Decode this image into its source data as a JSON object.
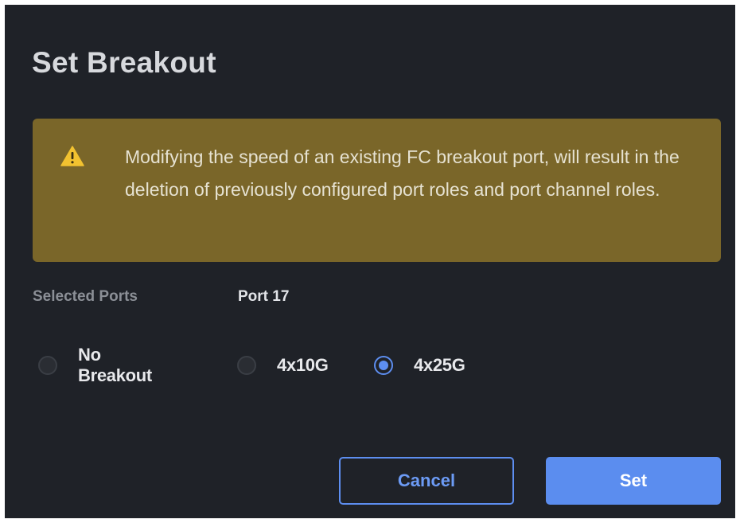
{
  "dialog": {
    "title": "Set Breakout",
    "warning": {
      "icon": "warning-triangle-icon",
      "text": "Modifying the speed of an existing FC breakout port, will result in the deletion of previously configured port roles and port channel roles.",
      "background_color": "#7a6629",
      "icon_color": "#f2c230"
    },
    "selected_ports": {
      "label": "Selected Ports",
      "value": "Port 17"
    },
    "breakout_options": [
      {
        "label": "No Breakout",
        "selected": false
      },
      {
        "label": "4x10G",
        "selected": false
      },
      {
        "label": "4x25G",
        "selected": true
      }
    ],
    "buttons": {
      "cancel_label": "Cancel",
      "set_label": "Set"
    },
    "colors": {
      "background": "#1f2228",
      "accent": "#5b8def"
    }
  }
}
